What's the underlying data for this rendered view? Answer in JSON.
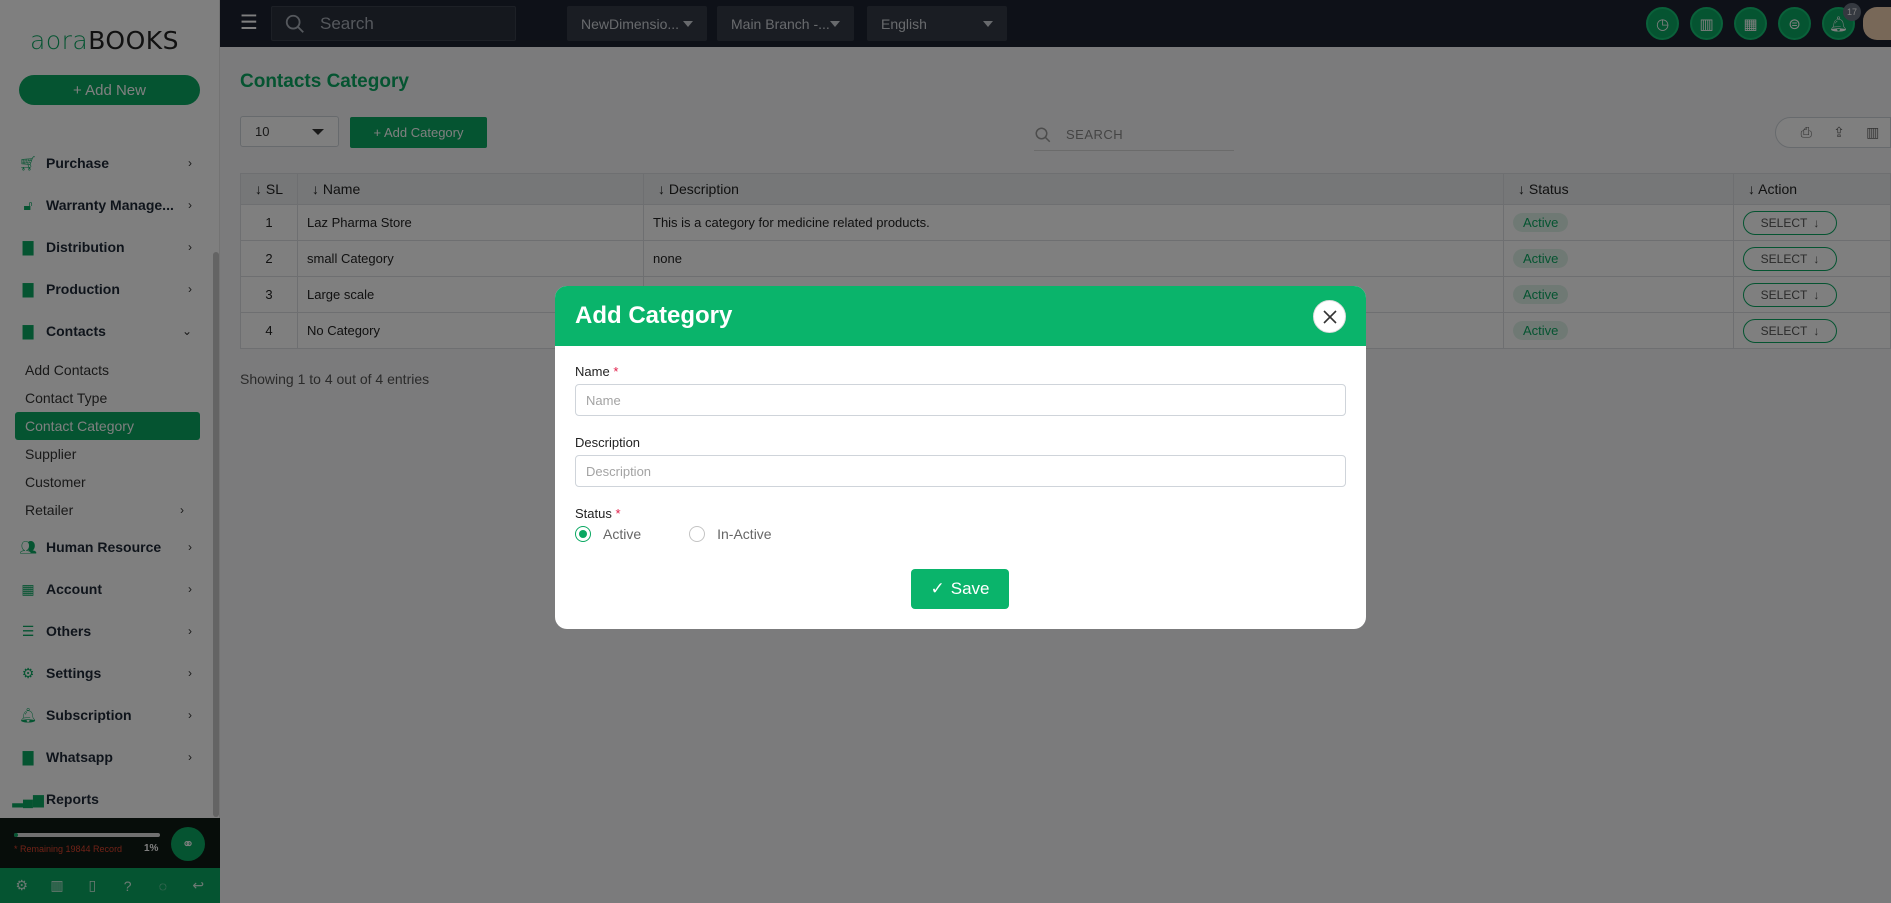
{
  "logo": {
    "part1": "aora",
    "part2": "BOOKS"
  },
  "sidebar": {
    "add_new": "+ Add New",
    "items": [
      {
        "label": "Purchase",
        "icon": "cart-icon"
      },
      {
        "label": "Warranty Manage...",
        "icon": "unlock-icon"
      },
      {
        "label": "Distribution",
        "icon": "document-icon"
      },
      {
        "label": "Production",
        "icon": "document-icon"
      },
      {
        "label": "Contacts",
        "icon": "document-icon"
      },
      {
        "label": "Human Resource",
        "icon": "users-icon"
      },
      {
        "label": "Account",
        "icon": "calculator-icon"
      },
      {
        "label": "Others",
        "icon": "list-icon"
      },
      {
        "label": "Settings",
        "icon": "gear-icon"
      },
      {
        "label": "Subscription",
        "icon": "bell-icon"
      },
      {
        "label": "Whatsapp",
        "icon": "document-icon"
      },
      {
        "label": "Reports",
        "icon": "bar-chart-icon"
      }
    ],
    "contacts_sub": [
      "Add Contacts",
      "Contact Type",
      "Contact Category",
      "Supplier",
      "Customer",
      "Retailer"
    ],
    "remaining": "* Remaining 19844 Record",
    "percent": "1%",
    "progress": 0.01
  },
  "topbar": {
    "search_placeholder": "Search",
    "company": "NewDimensio...",
    "branch": "Main Branch -...",
    "language": "English",
    "notification_count": "17"
  },
  "main": {
    "title": "Contacts Category",
    "per_page": "10",
    "add_category": "+ Add Category",
    "search_placeholder": "SEARCH",
    "columns": [
      "↓ SL",
      "↓ Name",
      "↓ Description",
      "↓ Status",
      "↓ Action"
    ],
    "rows": [
      {
        "sl": "1",
        "name": "Laz Pharma Store",
        "description": "This is a category for medicine related products.",
        "status": "Active",
        "action": "SELECT"
      },
      {
        "sl": "2",
        "name": "small Category",
        "description": "none",
        "status": "Active",
        "action": "SELECT"
      },
      {
        "sl": "3",
        "name": "Large scale",
        "description": "",
        "status": "Active",
        "action": "SELECT"
      },
      {
        "sl": "4",
        "name": "No Category",
        "description": "",
        "status": "Active",
        "action": "SELECT"
      }
    ],
    "showing": "Showing 1 to 4 out of 4 entries"
  },
  "modal": {
    "title": "Add Category",
    "name_label": "Name",
    "name_placeholder": "Name",
    "desc_label": "Description",
    "desc_placeholder": "Description",
    "status_label": "Status",
    "status_options": [
      "Active",
      "In-Active"
    ],
    "save": "Save",
    "required_mark": "*"
  },
  "colors": {
    "accent": "#0aa862",
    "topbar": "#1c2230"
  }
}
